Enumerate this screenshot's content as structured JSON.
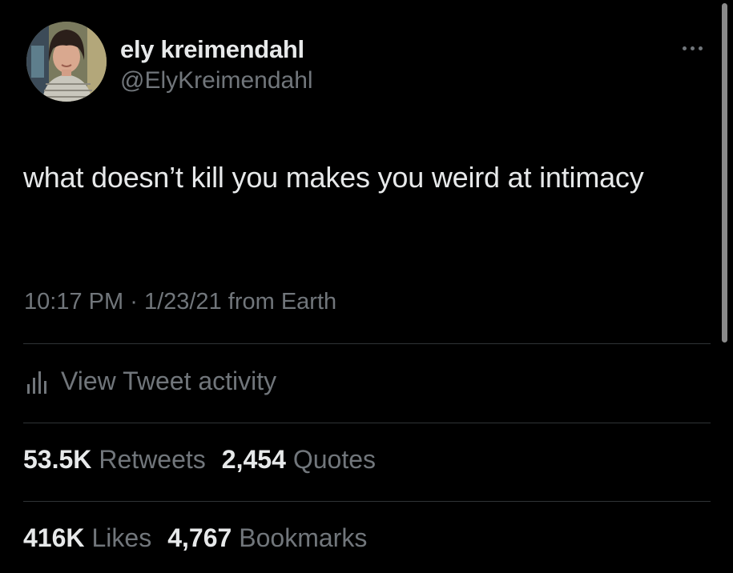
{
  "user": {
    "display_name": "ely kreimendahl",
    "handle": "@ElyKreimendahl",
    "avatar_icon": "profile-photo"
  },
  "tweet": {
    "text": "what doesn’t kill you makes you weird at intimacy",
    "time": "10:17 PM",
    "separator": "·",
    "date": "1/23/21",
    "source": "from Earth"
  },
  "activity": {
    "label": "View Tweet activity",
    "icon": "bar-chart-icon"
  },
  "stats": {
    "retweets_count": "53.5K",
    "retweets_label": "Retweets",
    "quotes_count": "2,454",
    "quotes_label": "Quotes",
    "likes_count": "416K",
    "likes_label": "Likes",
    "bookmarks_count": "4,767",
    "bookmarks_label": "Bookmarks"
  },
  "colors": {
    "background": "#000000",
    "primary_text": "#e7e9ea",
    "secondary_text": "#71767b",
    "divider": "#2f3336"
  }
}
